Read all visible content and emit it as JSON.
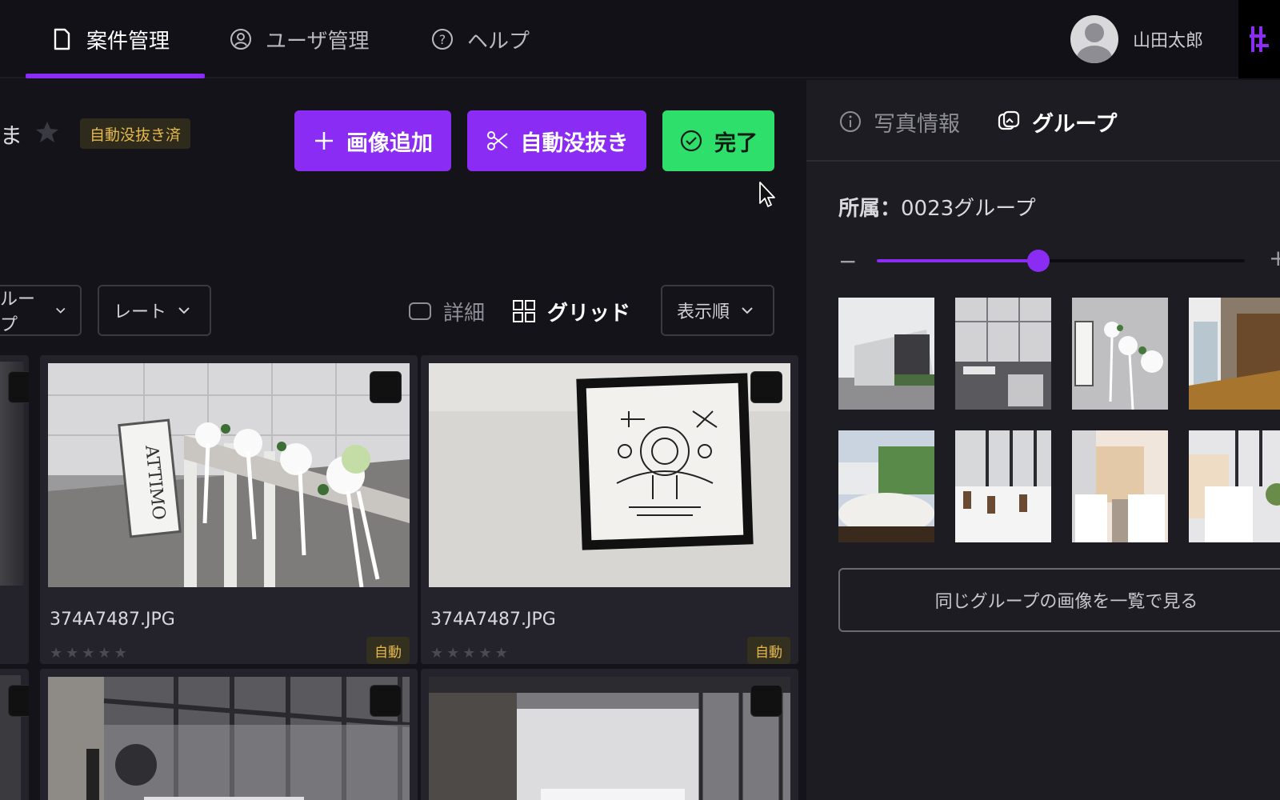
{
  "nav": {
    "items": [
      {
        "label": "案件管理",
        "icon": "document-icon",
        "active": true
      },
      {
        "label": "ユーザ管理",
        "icon": "user-circle-icon",
        "active": false
      },
      {
        "label": "ヘルプ",
        "icon": "help-circle-icon",
        "active": false
      }
    ],
    "user_name": "山田太郎",
    "accent": "#8a2cf3"
  },
  "header": {
    "title_fragment": "ま",
    "status_badge": "自動没抜き済",
    "buttons": {
      "add_image": "画像追加",
      "auto_cutout": "自動没抜き",
      "complete": "完了"
    }
  },
  "filters": {
    "group_fragment": "ループ",
    "rate": "レート",
    "detail_view": "詳細",
    "grid_view": "グリッド",
    "sort": "表示順"
  },
  "photos": [
    {
      "name": "374A7487.JPG",
      "badge": "自動",
      "rating": 0
    },
    {
      "name": "374A7487.JPG",
      "badge": "自動",
      "rating": 0
    }
  ],
  "panel": {
    "tabs": {
      "info": "写真情報",
      "group": "グループ"
    },
    "affiliation_label": "所属：",
    "affiliation_value": "0023グループ",
    "zoom_minus": "−",
    "zoom_plus": "+",
    "zoom_level": 0.44,
    "view_group_button": "同じグループの画像を一覧で見る"
  },
  "colors": {
    "purple": "#8a2cf3",
    "green": "#2ee06b",
    "badge_text": "#e5b84c"
  }
}
